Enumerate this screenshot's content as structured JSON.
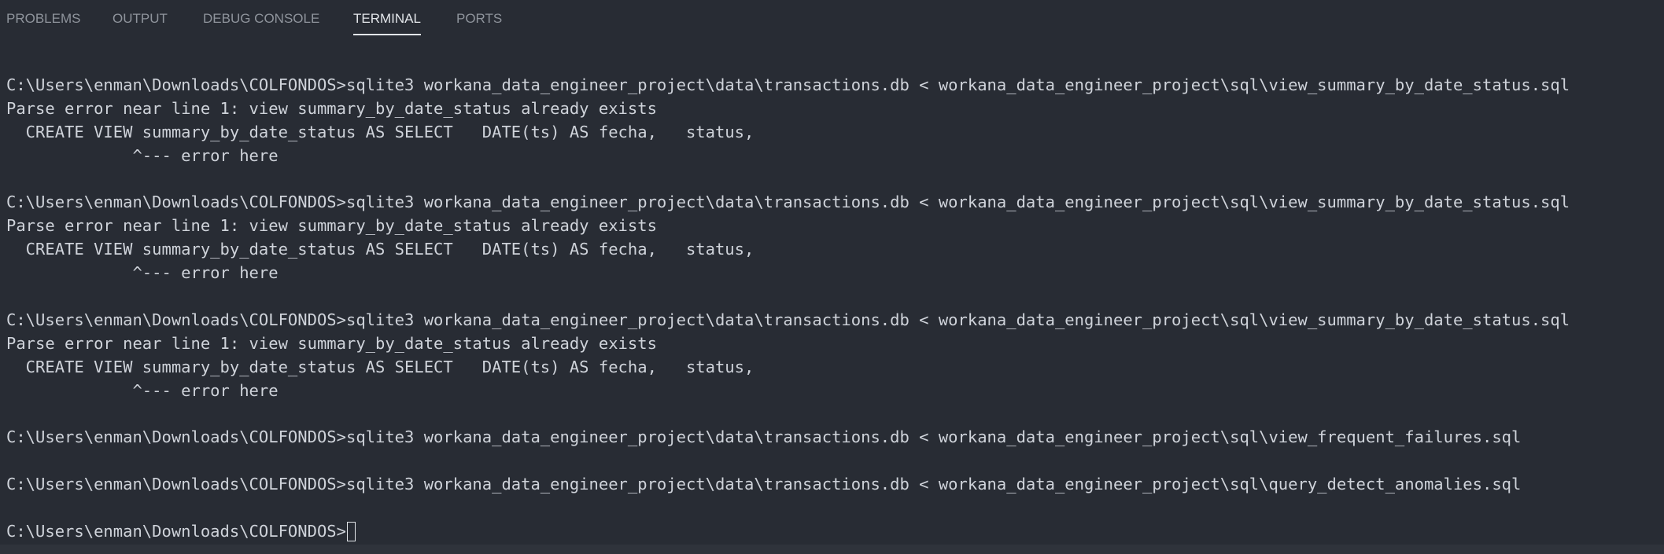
{
  "tabs": [
    {
      "label": "PROBLEMS"
    },
    {
      "label": "OUTPUT"
    },
    {
      "label": "DEBUG CONSOLE"
    },
    {
      "label": "TERMINAL"
    },
    {
      "label": "PORTS"
    }
  ],
  "active_tab": "TERMINAL",
  "terminal": {
    "lines": [
      "C:\\Users\\enman\\Downloads\\COLFONDOS>sqlite3 workana_data_engineer_project\\data\\transactions.db < workana_data_engineer_project\\sql\\view_summary_by_date_status.sql",
      "Parse error near line 1: view summary_by_date_status already exists",
      "  CREATE VIEW summary_by_date_status AS SELECT   DATE(ts) AS fecha,   status,",
      "             ^--- error here",
      "",
      "C:\\Users\\enman\\Downloads\\COLFONDOS>sqlite3 workana_data_engineer_project\\data\\transactions.db < workana_data_engineer_project\\sql\\view_summary_by_date_status.sql",
      "Parse error near line 1: view summary_by_date_status already exists",
      "  CREATE VIEW summary_by_date_status AS SELECT   DATE(ts) AS fecha,   status,",
      "             ^--- error here",
      "",
      "C:\\Users\\enman\\Downloads\\COLFONDOS>sqlite3 workana_data_engineer_project\\data\\transactions.db < workana_data_engineer_project\\sql\\view_summary_by_date_status.sql",
      "Parse error near line 1: view summary_by_date_status already exists",
      "  CREATE VIEW summary_by_date_status AS SELECT   DATE(ts) AS fecha,   status,",
      "             ^--- error here",
      "",
      "C:\\Users\\enman\\Downloads\\COLFONDOS>sqlite3 workana_data_engineer_project\\data\\transactions.db < workana_data_engineer_project\\sql\\view_frequent_failures.sql",
      "",
      "C:\\Users\\enman\\Downloads\\COLFONDOS>sqlite3 workana_data_engineer_project\\data\\transactions.db < workana_data_engineer_project\\sql\\query_detect_anomalies.sql",
      ""
    ],
    "prompt": "C:\\Users\\enman\\Downloads\\COLFONDOS>"
  },
  "colors": {
    "background": "#282c34",
    "text": "#cfd3da",
    "tab_inactive": "#8f949c",
    "tab_active": "#e3e6ea"
  }
}
